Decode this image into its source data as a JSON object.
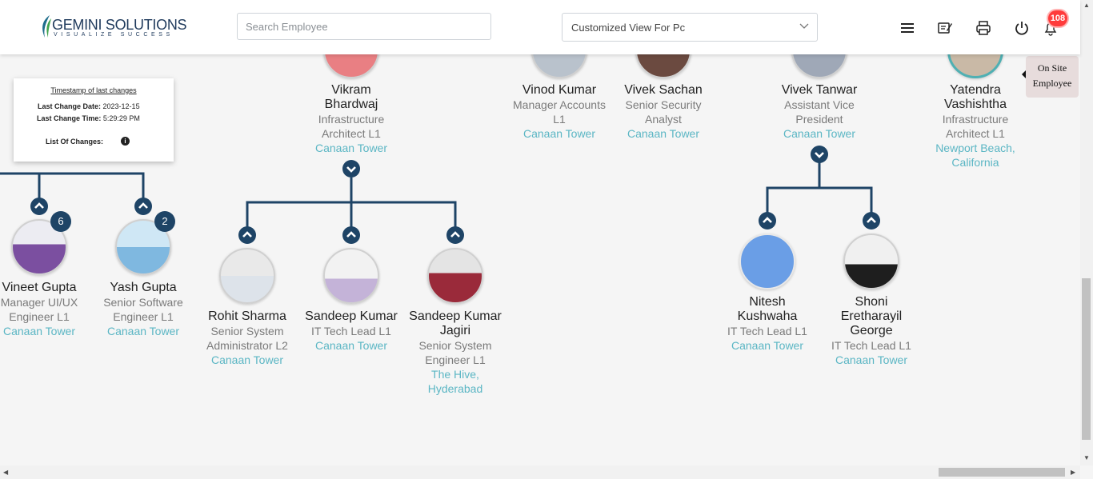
{
  "header": {
    "logo_name": "GEMINI SOLUTIONS",
    "logo_tagline": "VISUALIZE SUCCESS",
    "search_placeholder": "Search Employee",
    "view_select_value": "Customized View For Pc",
    "notification_count": "108",
    "icons": [
      "menu-icon",
      "edit-note-icon",
      "print-icon",
      "power-icon",
      "bell-icon"
    ]
  },
  "timestamp_card": {
    "title": "Timestamp of last changes",
    "date_label": "Last Change Date:",
    "date_value": "2023-12-15",
    "time_label": "Last Change Time:",
    "time_value": "5:29:29 PM",
    "changes_label": "List Of Changes:"
  },
  "onsite_tab": {
    "line1": "On Site",
    "line2": "Employee"
  },
  "colors": {
    "connector": "#1e4466",
    "location": "#5bb6c4",
    "badge": "#ff3b3b"
  },
  "employees": {
    "vikram": {
      "name": "Vikram Bhardwaj",
      "title": "Infrastructure Architect L1",
      "location": "Canaan Tower"
    },
    "vinod": {
      "name": "Vinod Kumar",
      "title": "Manager Accounts L1",
      "location": "Canaan Tower"
    },
    "vivek_s": {
      "name": "Vivek Sachan",
      "title": "Senior Security Analyst",
      "location": "Canaan Tower"
    },
    "vivek_t": {
      "name": "Vivek Tanwar",
      "title": "Assistant Vice President",
      "location": "Canaan Tower"
    },
    "yatendra": {
      "name": "Yatendra Vashishtha",
      "title": "Infrastructure Architect L1",
      "location": "Newport Beach, California"
    },
    "vineet": {
      "name": "Vineet Gupta",
      "title": "Manager UI/UX Engineer L1",
      "location": "Canaan Tower",
      "reports": "6"
    },
    "yash": {
      "name": "Yash Gupta",
      "title": "Senior Software Engineer L1",
      "location": "Canaan Tower",
      "reports": "2"
    },
    "rohit": {
      "name": "Rohit Sharma",
      "title": "Senior System Administrator L2",
      "location": "Canaan Tower"
    },
    "sandeep": {
      "name": "Sandeep Kumar",
      "title": "IT Tech Lead L1",
      "location": "Canaan Tower"
    },
    "sandeep_j": {
      "name": "Sandeep Kumar Jagiri",
      "title": "Senior System Engineer L1",
      "location": "The Hive, Hyderabad"
    },
    "nitesh": {
      "name": "Nitesh Kushwaha",
      "title": "IT Tech Lead L1",
      "location": "Canaan Tower"
    },
    "shoni": {
      "name": "Shoni Eretharayil George",
      "title": "IT Tech Lead L1",
      "location": "Canaan Tower"
    }
  }
}
